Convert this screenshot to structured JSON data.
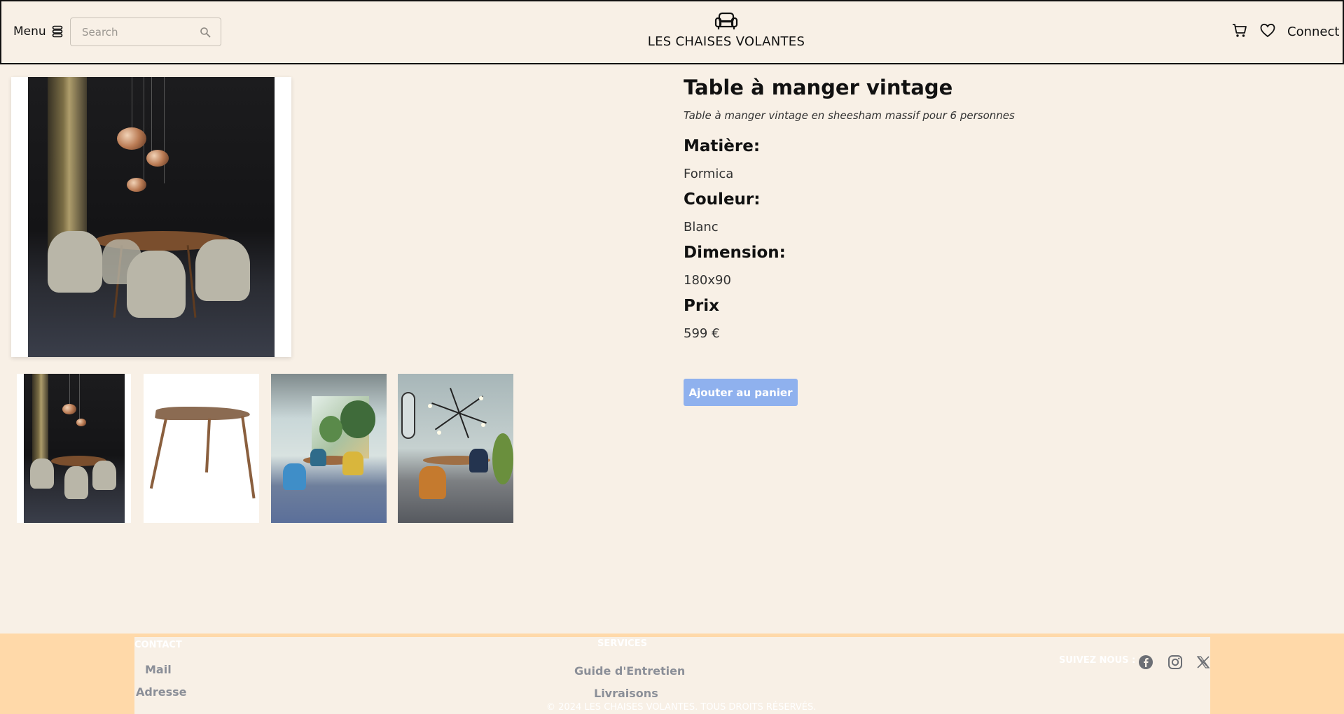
{
  "header": {
    "menu_label": "Menu",
    "search_placeholder": "Search",
    "brand_name": "LES CHAISES VOLANTES",
    "connect_label": "Connect",
    "icons": {
      "menu": "stack-icon",
      "search": "search-icon",
      "brand": "armchair-icon",
      "cart": "cart-icon",
      "wishlist": "heart-icon"
    }
  },
  "gallery": {
    "main_image": "dining-room-dark-photo",
    "thumbnails": [
      "dining-room-dark-photo",
      "triangular-table-photo",
      "dining-room-bright-photo",
      "dining-room-grey-photo"
    ]
  },
  "product": {
    "title": "Table à manger vintage",
    "subtitle": "Table à manger vintage en sheesham massif pour 6 personnes",
    "specs": [
      {
        "label": "Matière:",
        "value": "Formica"
      },
      {
        "label": "Couleur:",
        "value": "Blanc"
      },
      {
        "label": "Dimension:",
        "value": "180x90"
      },
      {
        "label": "Prix",
        "value": "599 €"
      }
    ],
    "add_to_cart_label": "Ajouter au panier",
    "button_color": "#8fb1ee"
  },
  "footer": {
    "contact_heading": "CONTACT",
    "contact_links": [
      "Mail",
      "Adresse"
    ],
    "services_heading": "SERVICES",
    "services_links": [
      "Guide d'Entretien",
      "Livraisons"
    ],
    "follow_label": "SUIVEZ NOUS :",
    "social_icons": [
      "facebook-icon",
      "instagram-icon",
      "x-icon"
    ],
    "copyright": "© 2024 LES CHAISES VOLANTES. TOUS DROITS RÉSERVÉS.",
    "band_color": "#ffd9a9"
  }
}
